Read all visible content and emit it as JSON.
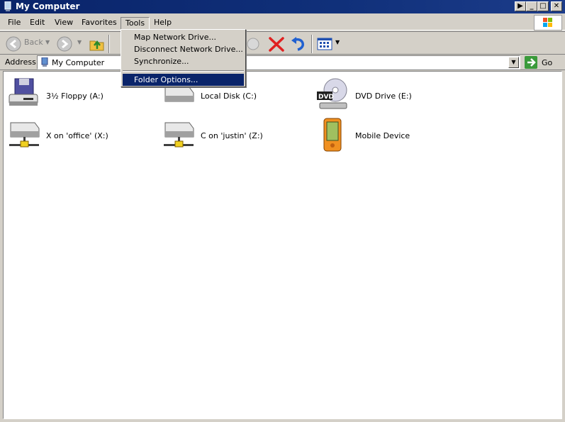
{
  "window": {
    "title": "My Computer",
    "minimize": "_",
    "maximize": "□",
    "close": "✕",
    "extra": "▶"
  },
  "menubar": {
    "items": [
      {
        "label": "File"
      },
      {
        "label": "Edit"
      },
      {
        "label": "View"
      },
      {
        "label": "Favorites"
      },
      {
        "label": "Tools"
      },
      {
        "label": "Help"
      }
    ],
    "open_menu": "Tools"
  },
  "toolbar": {
    "back_label": "Back",
    "icons": [
      "back-arrow-icon",
      "forward-arrow-icon",
      "up-folder-icon",
      "search-icon",
      "move-to-icon",
      "delete-icon",
      "undo-icon",
      "views-icon"
    ]
  },
  "address": {
    "label": "Address",
    "value": "My Computer",
    "go_label": "Go"
  },
  "tools_menu": {
    "items": [
      {
        "label": "Map Network Drive..."
      },
      {
        "label": "Disconnect Network Drive..."
      },
      {
        "label": "Synchronize..."
      },
      {
        "label": "Folder Options..."
      }
    ],
    "selected": "Folder Options..."
  },
  "drives": [
    {
      "label": "3½ Floppy (A:)",
      "icon": "floppy-drive-icon"
    },
    {
      "label": "Local Disk (C:)",
      "icon": "hard-disk-icon"
    },
    {
      "label": "DVD Drive (E:)",
      "icon": "dvd-drive-icon"
    },
    {
      "label": "X on 'office' (X:)",
      "icon": "network-drive-icon"
    },
    {
      "label": "C on 'justin' (Z:)",
      "icon": "network-drive-icon"
    },
    {
      "label": "Mobile Device",
      "icon": "mobile-device-icon"
    }
  ],
  "colors": {
    "title_bar": "#0a246a",
    "selection": "#0a246a",
    "chrome": "#d4d0c8",
    "delete_red": "#e02020",
    "undo_blue": "#2060d0"
  }
}
